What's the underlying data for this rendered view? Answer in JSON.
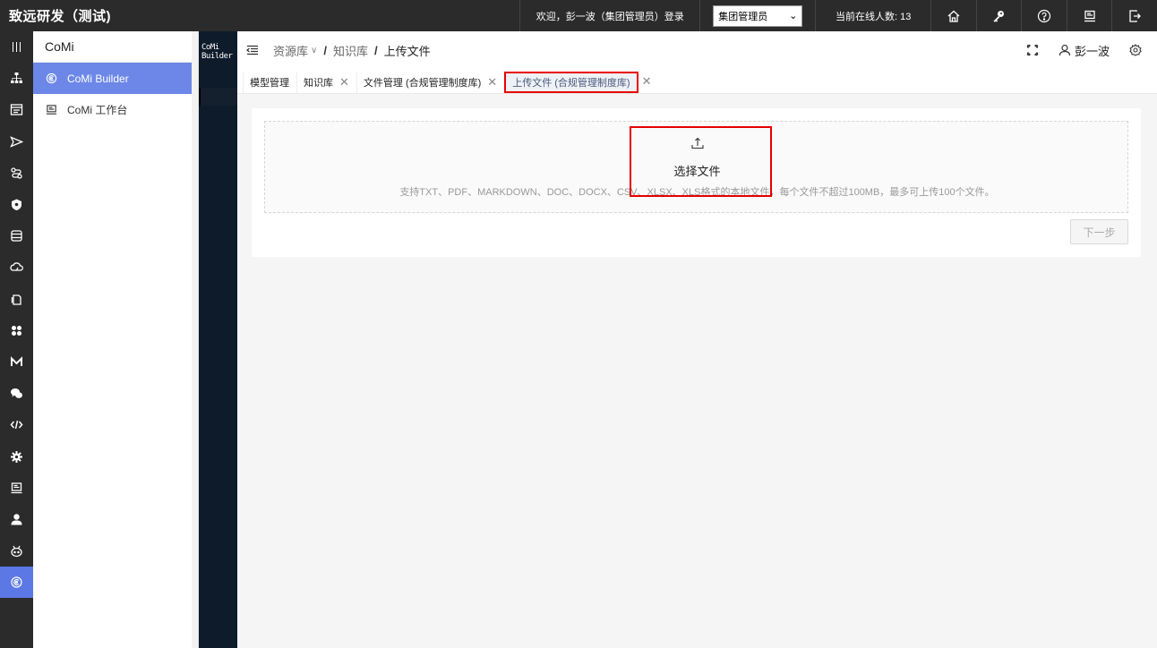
{
  "app": {
    "title": "致远研发（测试)"
  },
  "topbar": {
    "welcome": "欢迎，彭一波（集团管理员）登录",
    "role_selected": "集团管理员",
    "online_label": "当前在线人数: 13",
    "icons": [
      "home-icon",
      "key-icon",
      "help-icon",
      "monitor-icon",
      "logout-icon"
    ]
  },
  "rail": {
    "icons": [
      "grid-menu-icon",
      "org-chart-icon",
      "form-icon",
      "send-icon",
      "flow-icon",
      "shield-icon",
      "database-icon",
      "cloud-icon",
      "document-icon",
      "apps-icon",
      "m-logo-icon",
      "chat-icon",
      "code-icon",
      "settings-gear-icon",
      "desktop-icon",
      "user-icon",
      "robot-icon",
      "comi-icon"
    ],
    "active_index": 17
  },
  "submenu": {
    "title": "CoMi",
    "items": [
      {
        "label": "CoMi Builder",
        "icon": "comi-icon",
        "active": true
      },
      {
        "label": "CoMi 工作台",
        "icon": "laptop-icon",
        "active": false
      }
    ]
  },
  "darkstrip": {
    "logo": "CoMi Builder"
  },
  "breadcrumb": {
    "items": [
      "资源库",
      "知识库",
      "上传文件"
    ]
  },
  "header": {
    "user_name": "彭一波"
  },
  "tabs": [
    {
      "label": "模型管理",
      "closable": false,
      "active": false
    },
    {
      "label": "知识库",
      "closable": true,
      "active": false
    },
    {
      "label": "文件管理 (合规管理制度库)",
      "closable": true,
      "active": false
    },
    {
      "label": "上传文件 (合规管理制度库)",
      "closable": true,
      "active": true
    }
  ],
  "upload": {
    "choose_label": "选择文件",
    "hint": "支持TXT、PDF、MARKDOWN、DOC、DOCX、CSV、XLSX、XLS格式的本地文件，每个文件不超过100MB，最多可上传100个文件。"
  },
  "next_button": "下一步",
  "colors": {
    "topbar": "#2b2b2b",
    "accent": "#6c87e8",
    "highlight": "#e60000",
    "darkstrip": "#0d1b2a"
  }
}
